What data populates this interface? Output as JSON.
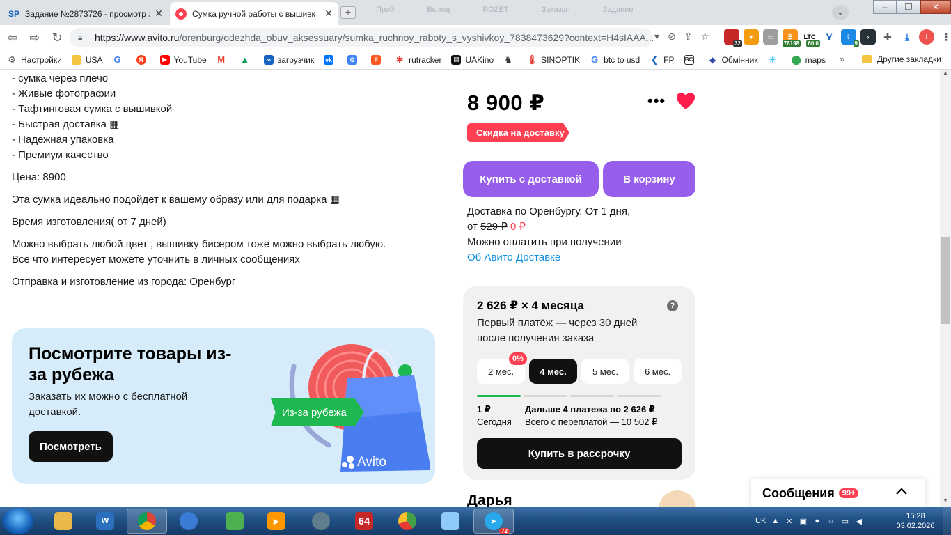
{
  "browser": {
    "tabs": [
      {
        "title": "Задание №2873726 - просмотр з",
        "favicon": "SP"
      },
      {
        "title": "Сумка ручной работы с вышивк",
        "favicon": ""
      }
    ],
    "ghost_tabs": [
      "Прой",
      "Выход",
      "ROZET",
      "Заказан",
      "Задание"
    ],
    "url_main": "https://www.avito.ru",
    "url_path": "/orenburg/odezhda_obuv_aksessuary/sumka_ruchnoy_raboty_s_vyshivkoy_7838473629?context=H4sIAAA...",
    "extensions": [
      {
        "label": "",
        "badge": "32",
        "color": "#c62828"
      },
      {
        "label": "",
        "badge": "",
        "color": "#f39c12"
      },
      {
        "label": "",
        "badge": "",
        "color": "#9e9e9e"
      },
      {
        "label": "₿",
        "badge": "78198",
        "color": "#f7931a"
      },
      {
        "label": "LTC",
        "badge": "60.0",
        "color": "#2e7d32"
      },
      {
        "label": "Y",
        "badge": "",
        "color": "#1565c0"
      },
      {
        "label": "",
        "badge": "9",
        "color": "#1e88e5"
      },
      {
        "label": "",
        "badge": "",
        "color": "#263238"
      }
    ],
    "bookmarks": [
      {
        "label": "Настройки",
        "icon": "gear-icon",
        "color": "#5f6368"
      },
      {
        "label": "USA",
        "icon": "folder-icon",
        "color": "#f5c542"
      },
      {
        "label": "",
        "icon": "google-icon",
        "color": "#4285f4"
      },
      {
        "label": "",
        "icon": "yandex-icon",
        "color": "#fc3f1d"
      },
      {
        "label": "YouTube",
        "icon": "youtube-icon",
        "color": "#ff0000"
      },
      {
        "label": "",
        "icon": "gmail-icon",
        "color": "#ea4335"
      },
      {
        "label": "",
        "icon": "drive-icon",
        "color": "#0f9d58"
      },
      {
        "label": "загрузчик",
        "icon": "loader-icon",
        "color": "#1565c0"
      },
      {
        "label": "",
        "icon": "vk-icon",
        "color": "#0077ff"
      },
      {
        "label": "",
        "icon": "translate-icon",
        "color": "#4285f4"
      },
      {
        "label": "",
        "icon": "fp-icon",
        "color": "#ff5722"
      },
      {
        "label": "rutracker",
        "icon": "rutracker-icon",
        "color": "#e53935"
      },
      {
        "label": "UAKino",
        "icon": "uakino-icon",
        "color": "#111111"
      },
      {
        "label": "",
        "icon": "chess-icon",
        "color": "#333333"
      },
      {
        "label": "SINOPTIK",
        "icon": "thermometer-icon",
        "color": "#e53935"
      },
      {
        "label": "btc to usd",
        "icon": "google-icon",
        "color": "#4285f4"
      },
      {
        "label": "FP",
        "icon": "fp-arrow-icon",
        "color": "#1565c0"
      },
      {
        "label": "",
        "icon": "bc-icon",
        "color": "#333333"
      },
      {
        "label": "Обмінник",
        "icon": "exchange-icon",
        "color": "#3949ab"
      },
      {
        "label": "",
        "icon": "snow-icon",
        "color": "#29b6f6"
      },
      {
        "label": "maps",
        "icon": "maps-icon",
        "color": "#34a853"
      }
    ],
    "bookmarks_more": "»",
    "other_bookmarks": "Другие закладки"
  },
  "description": {
    "bullets": [
      "- сумка через плечо",
      "- Живые фотографии",
      "- Тафтинговая сумка с вышивкой",
      "- Быстрая доставка ▦",
      "- Надежная упаковка",
      "- Премиум качество"
    ],
    "paragraphs": [
      [
        "Цена: 8900"
      ],
      [
        "Эта сумка идеально подойдет к вашему образу или для подарка ▦"
      ],
      [
        "Время изготовления( от 7 дней)"
      ],
      [
        "Можно выбрать любой цвет , вышивку бисером тоже можно выбрать любую.",
        "Все что интересует можете уточнить в личных сообщениях"
      ],
      [
        "Отправка и изготовление из города: Оренбург"
      ]
    ]
  },
  "promo": {
    "title": "Посмотрите товары из-за рубежа",
    "subtitle": "Заказать их можно с бесплатной доставкой.",
    "button": "Посмотреть",
    "tag": "Из-за рубежа",
    "bag_logo": "Avito"
  },
  "product": {
    "price": "8 900 ₽",
    "discount_badge": "Скидка на доставку",
    "buy_button": "Купить с доставкой",
    "cart_button": "В корзину",
    "delivery_line1": "Доставка по Оренбургу. От 1 дня,",
    "delivery_from": "от ",
    "delivery_old": "529 ₽",
    "delivery_new": "0 ₽",
    "pay_on_receipt": "Можно оплатить при получении",
    "delivery_link": "Об Авито Доставке"
  },
  "installment": {
    "title": "2 626 ₽ × 4 месяца",
    "help": "?",
    "subtitle": "Первый платёж — через 30 дней после получения заказа",
    "months": [
      "2 мес.",
      "4 мес.",
      "5 мес.",
      "6 мес."
    ],
    "selected_index": 1,
    "zero_badge": "0%",
    "first_amount": "1 ₽",
    "first_when": "Сегодня",
    "next_payments": "Дальше 4 платежа по 2 626 ₽",
    "total": "Всего с переплатой — 10 502 ₽",
    "button": "Купить в рассрочку"
  },
  "seller": {
    "name": "Дарья"
  },
  "messages": {
    "label": "Сообщения",
    "count": "99+"
  },
  "taskbar": {
    "apps": [
      {
        "icon": "explorer-icon",
        "label": "",
        "color": "#e8b84a"
      },
      {
        "icon": "wm-icon",
        "label": "",
        "color": "#2c6fbd"
      },
      {
        "icon": "chrome-icon",
        "label": "",
        "color": "#db4437"
      },
      {
        "icon": "globe-icon",
        "label": "",
        "color": "#3a7bd5"
      },
      {
        "icon": "cpu-icon",
        "label": "",
        "color": "#4caf50"
      },
      {
        "icon": "media-icon",
        "label": "",
        "color": "#ff9800"
      },
      {
        "icon": "clock-app-icon",
        "label": "",
        "color": "#607d8b"
      },
      {
        "icon": "aida64-icon",
        "label": "64",
        "color": "#c62828"
      },
      {
        "icon": "chart-icon",
        "label": "",
        "color": "#43a047"
      },
      {
        "icon": "notepad-icon",
        "label": "",
        "color": "#90caf9"
      },
      {
        "icon": "telegram-icon",
        "label": "72",
        "color": "#29a9eb"
      }
    ],
    "lang": "UK",
    "time": "15:28",
    "date": "03.02.2026"
  }
}
